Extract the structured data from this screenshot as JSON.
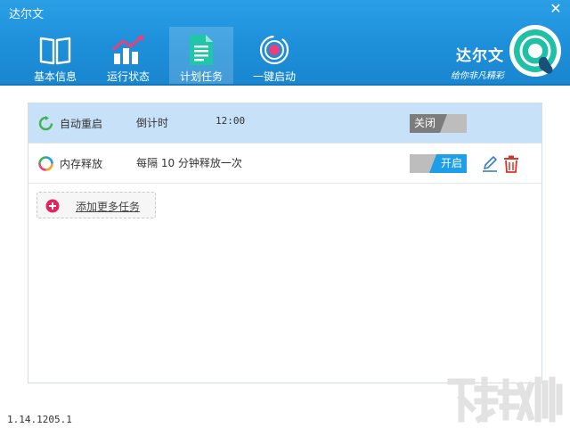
{
  "window": {
    "title": "达尔文",
    "close_glyph": "✕"
  },
  "nav": {
    "items": [
      {
        "label": "基本信息",
        "icon": "book-icon"
      },
      {
        "label": "运行状态",
        "icon": "chart-icon"
      },
      {
        "label": "计划任务",
        "icon": "document-icon",
        "active": true
      },
      {
        "label": "一键启动",
        "icon": "record-icon"
      }
    ]
  },
  "brand": {
    "name": "达尔文",
    "slogan": "给你非凡精彩"
  },
  "tasks": [
    {
      "name": "自动重启",
      "type": "倒计时",
      "time": "12:00",
      "toggle": "关闭",
      "enabled": false,
      "selected": true
    },
    {
      "name": "内存释放",
      "type": "每隔 10 分钟释放一次",
      "time": "",
      "toggle": "开启",
      "enabled": true,
      "selected": false
    }
  ],
  "add_task": {
    "label": "添加更多任务"
  },
  "version": "1.14.1205.1",
  "colors": {
    "header": "#1d8fd9",
    "selected_row": "#c7e1f8",
    "toggle_on": "#1e9ee8",
    "toggle_off": "#7c7c7c",
    "delete": "#d9342b",
    "add_icon": "#e0245e"
  }
}
